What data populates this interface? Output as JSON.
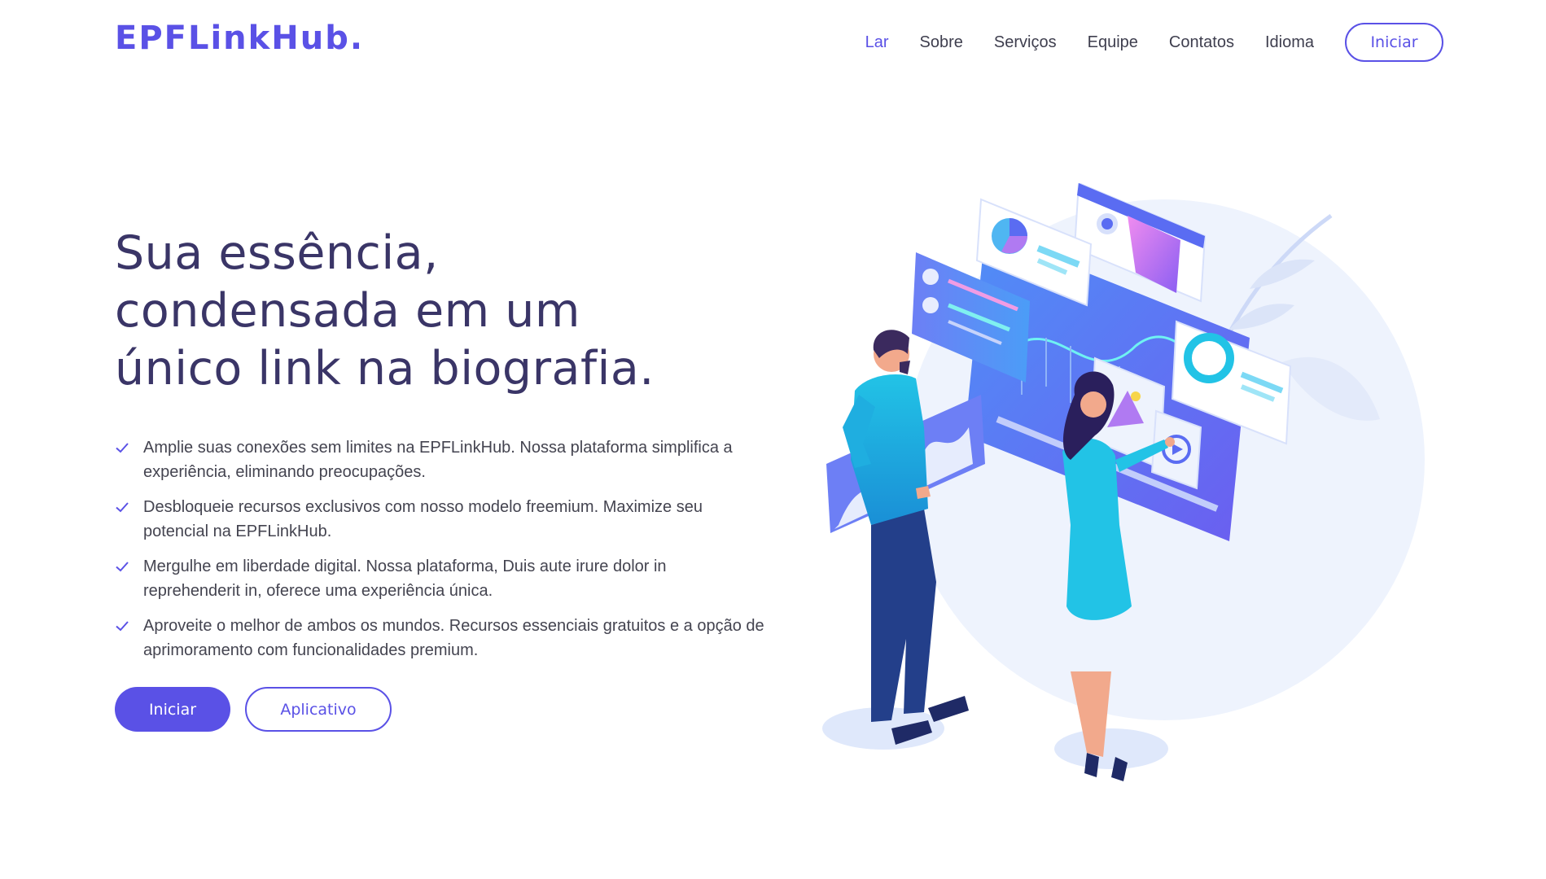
{
  "header": {
    "logo": "EPFLinkHub.",
    "nav": [
      {
        "label": "Lar",
        "active": true
      },
      {
        "label": "Sobre",
        "active": false
      },
      {
        "label": "Serviços",
        "active": false
      },
      {
        "label": "Equipe",
        "active": false
      },
      {
        "label": "Contatos",
        "active": false
      },
      {
        "label": "Idioma",
        "active": false
      }
    ],
    "cta_label": "Iniciar"
  },
  "hero": {
    "headline_lines": [
      "Sua essência,",
      "condensada em um",
      "único link na biografia."
    ],
    "features": [
      "Amplie suas conexões sem limites na EPFLinkHub. Nossa plataforma simplifica a experiência, eliminando preocupações.",
      "Desbloqueie recursos exclusivos com nosso modelo freemium. Maximize seu potencial na EPFLinkHub.",
      "Mergulhe em liberdade digital. Nossa plataforma, Duis aute irure dolor in reprehenderit in, oferece uma experiência única.",
      "Aproveite o melhor de ambos os mundos. Recursos essenciais gratuitos e a opção de aprimoramento com funcionalidades premium."
    ],
    "primary_button": "Iniciar",
    "secondary_button": "Aplicativo"
  },
  "colors": {
    "accent": "#5a51e6",
    "headline": "#3a3567",
    "body_text": "#444450"
  },
  "icons": {
    "feature_bullet": "check-icon"
  }
}
